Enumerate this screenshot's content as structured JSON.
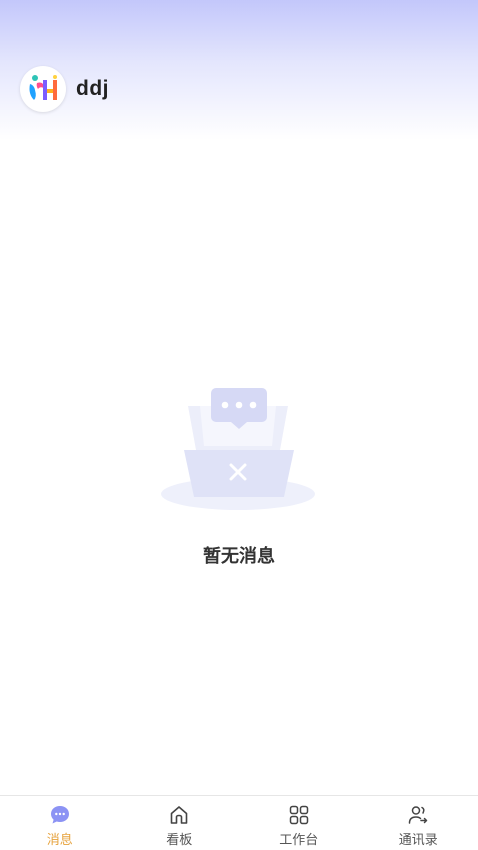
{
  "header": {
    "username": "ddj",
    "avatar_icon": "app-logo-icon"
  },
  "empty_state": {
    "icon": "empty-inbox-icon",
    "text": "暂无消息"
  },
  "tabbar": {
    "items": [
      {
        "label": "消息",
        "icon": "chat-bubble-icon",
        "active": true
      },
      {
        "label": "看板",
        "icon": "home-icon",
        "active": false
      },
      {
        "label": "工作台",
        "icon": "grid-icon",
        "active": false
      },
      {
        "label": "通讯录",
        "icon": "contacts-icon",
        "active": false
      }
    ],
    "active_color": "#e6a23c",
    "accent_color": "#8c93f4"
  }
}
